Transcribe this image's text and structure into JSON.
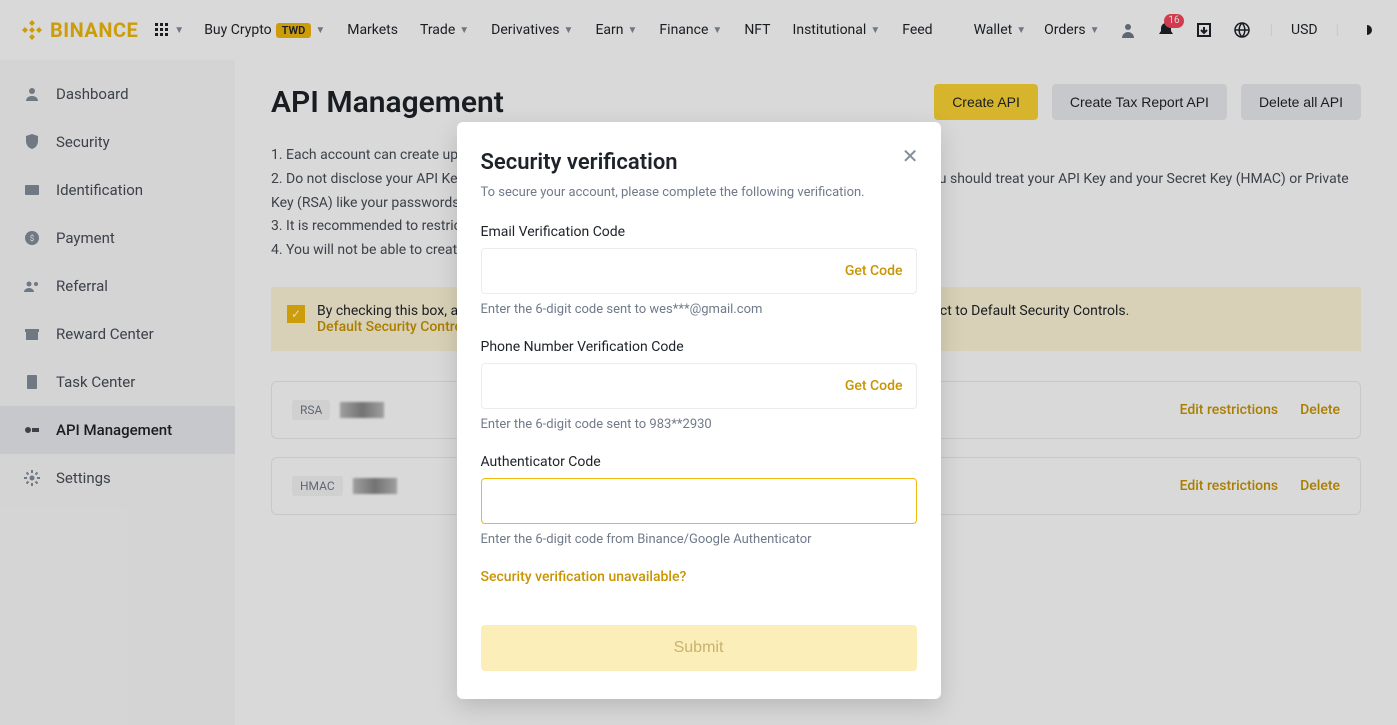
{
  "header": {
    "brand": "BINANCE",
    "nav": {
      "buy_crypto": "Buy Crypto",
      "pill": "TWD",
      "markets": "Markets",
      "trade": "Trade",
      "derivatives": "Derivatives",
      "earn": "Earn",
      "finance": "Finance",
      "nft": "NFT",
      "institutional": "Institutional",
      "feed": "Feed"
    },
    "right": {
      "wallet": "Wallet",
      "orders": "Orders",
      "currency": "USD",
      "notification_count": "16"
    }
  },
  "sidebar": {
    "dashboard": "Dashboard",
    "security": "Security",
    "identification": "Identification",
    "payment": "Payment",
    "referral": "Referral",
    "reward_center": "Reward Center",
    "task_center": "Task Center",
    "api_management": "API Management",
    "settings": "Settings"
  },
  "page": {
    "title": "API Management",
    "actions": {
      "create": "Create API",
      "tax": "Create Tax Report API",
      "delete_all": "Delete all API"
    },
    "notes": {
      "n1": "1. Each account can create up to 30 API Keys.",
      "n2": "2. Do not disclose your API Key, Secret Key (HMAC) or Private Key (RSA) to anyone to avoid asset losses. You should treat your API Key and your Secret Key (HMAC) or Private Key (RSA) like your passwords.",
      "n3": "3. It is recommended to restrict access to trusted IPs only to increase your account security.",
      "n4": "4. You will not be able to create an API if KYC is not completed."
    },
    "alert": {
      "text_a": "By checking this box, all existing API Key(s) on your master account and sub-account(s) will be subject to Default Security Controls.",
      "link": "Default Security Controls"
    },
    "cards": {
      "rsa": "RSA",
      "hmac": "HMAC",
      "edit": "Edit restrictions",
      "delete": "Delete"
    }
  },
  "modal": {
    "title": "Security verification",
    "subtitle": "To secure your account, please complete the following verification.",
    "email": {
      "label": "Email Verification Code",
      "get_code": "Get Code",
      "hint": "Enter the 6-digit code sent to wes***@gmail.com"
    },
    "phone": {
      "label": "Phone Number Verification Code",
      "get_code": "Get Code",
      "hint": "Enter the 6-digit code sent to 983**2930"
    },
    "auth": {
      "label": "Authenticator Code",
      "hint": "Enter the 6-digit code from Binance/Google Authenticator"
    },
    "help_link": "Security verification unavailable?",
    "submit": "Submit"
  }
}
